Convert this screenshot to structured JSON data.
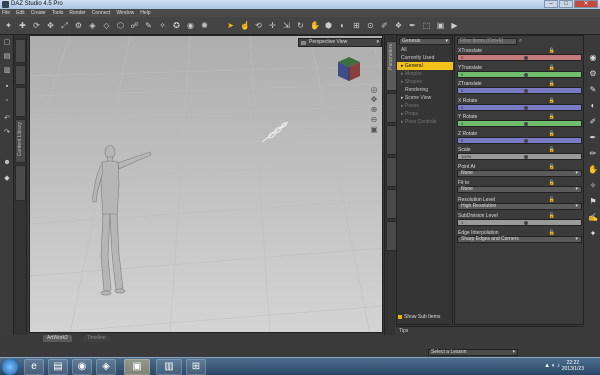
{
  "window": {
    "title": "DAZ Studio 4.5 Pro",
    "controls": [
      "–",
      "□",
      "✕"
    ]
  },
  "menu": [
    "File",
    "Edit",
    "Create",
    "Tools",
    "Render",
    "Connect",
    "Window",
    "Help"
  ],
  "viewport": {
    "camera_label": "Perspective View"
  },
  "viewport_tabs": [
    "ArtWork2",
    "Timeline"
  ],
  "left_tabs": [
    "",
    "",
    "",
    "Content Library",
    ""
  ],
  "surfaces": {
    "selector": "Genesis",
    "items": [
      {
        "label": "All",
        "state": "normal"
      },
      {
        "label": "Currently Used",
        "state": "normal"
      },
      {
        "label": "▸ General",
        "state": "selected"
      },
      {
        "label": "▸ Morphs",
        "state": "dim"
      },
      {
        "label": "▸ Shapes",
        "state": "dim"
      },
      {
        "label": "Rendering",
        "state": "normal"
      },
      {
        "label": "▸ Scene View",
        "state": "normal"
      },
      {
        "label": "▸ Poses",
        "state": "dim"
      },
      {
        "label": "▸ Props",
        "state": "dim"
      },
      {
        "label": "▸ Pose Controls",
        "state": "dim"
      }
    ],
    "show_sub_items": "Show Sub Items"
  },
  "params": {
    "filter_placeholder": "Filter Items (Ctrl+E)",
    "rows": [
      {
        "label": "XTranslate",
        "type": "slider",
        "color": "#c47a7a",
        "value": "0"
      },
      {
        "label": "YTranslate",
        "type": "slider",
        "color": "#6fbf6f",
        "value": "0"
      },
      {
        "label": "ZTranslate",
        "type": "slider",
        "color": "#7a7ac4",
        "value": "0"
      },
      {
        "label": "X Rotate",
        "type": "slider",
        "color": "#7a7ac4",
        "value": "0"
      },
      {
        "label": "Y Rotate",
        "type": "slider",
        "color": "#6fbf6f",
        "value": "0"
      },
      {
        "label": "Z Rotate",
        "type": "slider",
        "color": "#7a7ac4",
        "value": "0"
      },
      {
        "label": "Scale",
        "type": "slider",
        "color": "#9a9a9a",
        "value": "100%"
      },
      {
        "label": "Point At",
        "type": "dropdown",
        "value": "None"
      },
      {
        "label": "Fit to",
        "type": "dropdown",
        "value": "None"
      },
      {
        "label": "Resolution Level",
        "type": "dropdown",
        "value": "High Resolution"
      },
      {
        "label": "SubDivision Level",
        "type": "slider",
        "color": "#9a9a9a",
        "value": "1"
      },
      {
        "label": "Edge Interpolation",
        "type": "dropdown",
        "value": "Sharp Edges and Corners"
      }
    ]
  },
  "tips": "Tips",
  "lesson": "Select a Lesson",
  "taskbar": {
    "apps": [
      "IE",
      "Explorer",
      "Chrome",
      "DAZ",
      "Studio",
      "Folder",
      "Windows"
    ],
    "clock_time": "22:22",
    "clock_date": "2013/1/23"
  }
}
